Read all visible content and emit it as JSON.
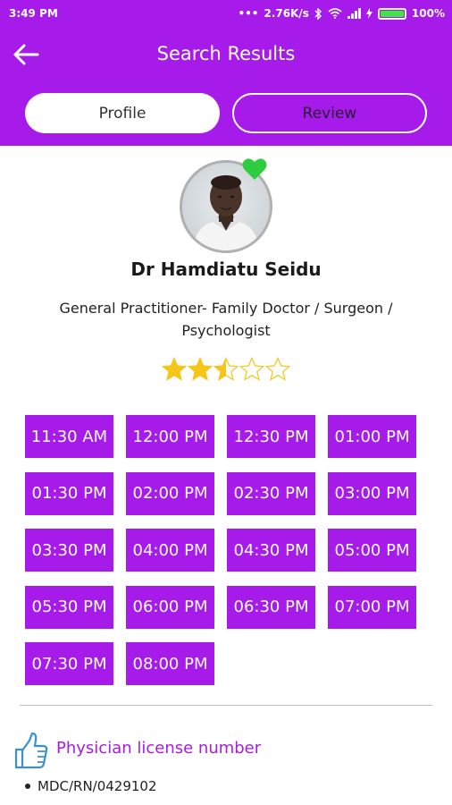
{
  "status_bar": {
    "time": "3:49 PM",
    "network_speed": "2.76K/s",
    "battery_percent": "100%",
    "battery_level": 1.0
  },
  "header": {
    "title": "Search Results",
    "back_icon": "arrow-left-icon"
  },
  "tabs": [
    {
      "label": "Profile",
      "active": true
    },
    {
      "label": "Review",
      "active": false
    }
  ],
  "doctor": {
    "name": "Dr Hamdiatu Seidu",
    "specialty": "General Practitioner- Family Doctor / Surgeon / Psychologist",
    "favorite_icon": "heart-icon",
    "rating": 2.5,
    "rating_max": 5
  },
  "time_slots": [
    "11:30 AM",
    "12:00 PM",
    "12:30 PM",
    "01:00 PM",
    "01:30 PM",
    "02:00 PM",
    "02:30 PM",
    "03:00 PM",
    "03:30 PM",
    "04:00 PM",
    "04:30 PM",
    "05:00 PM",
    "05:30 PM",
    "06:00 PM",
    "06:30 PM",
    "07:00 PM",
    "07:30 PM",
    "08:00 PM"
  ],
  "license": {
    "icon": "thumbs-up-icon",
    "title": "Physician license number",
    "items": [
      "MDC/RN/0429102"
    ]
  },
  "colors": {
    "accent": "#a71bea",
    "favorite": "#2ecc40",
    "star": "#f5c518"
  }
}
